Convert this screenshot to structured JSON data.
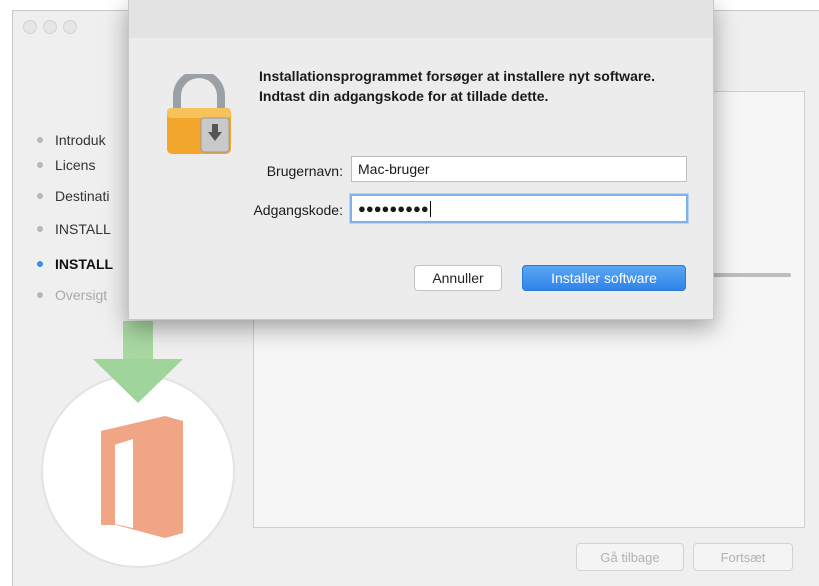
{
  "window": {
    "sidebar_steps": [
      {
        "label": "Introduk",
        "state": "done"
      },
      {
        "label": "Licens",
        "state": "done"
      },
      {
        "label": "Destinati",
        "state": "done"
      },
      {
        "label": "INSTALL",
        "state": "done"
      },
      {
        "label": "INSTALL",
        "state": "active"
      },
      {
        "label": "Oversigt",
        "state": "future"
      }
    ],
    "back_label": "Gå tilbage",
    "continue_label": "Fortsæt"
  },
  "dialog": {
    "message": "Installationsprogrammet forsøger at installere nyt software. Indtast din adgangskode for at tillade dette.",
    "username_label": "Brugernavn:",
    "username_value": "Mac-bruger",
    "password_label": "Adgangskode:",
    "password_value": "●●●●●●●●●",
    "cancel_label": "Annuller",
    "install_label": "Installer software"
  },
  "colors": {
    "accent_blue": "#2f84e9",
    "office_orange": "#f0a585",
    "arrow_green": "#9fd49a"
  },
  "icons": [
    "lock-icon",
    "download-arrow-icon",
    "office-logo-icon"
  ]
}
